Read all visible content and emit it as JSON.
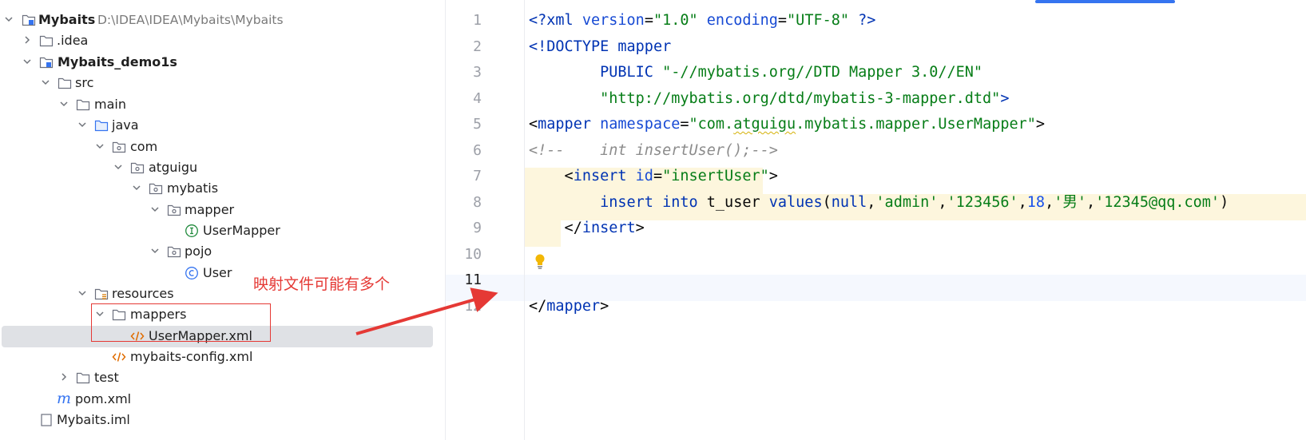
{
  "project_tree": {
    "root": {
      "name": "Mybaits",
      "path": "D:\\IDEA\\IDEA\\Mybaits\\Mybaits"
    },
    "items": [
      {
        "label": ".idea"
      },
      {
        "label": "Mybaits_demo1s"
      },
      {
        "label": "src"
      },
      {
        "label": "main"
      },
      {
        "label": "java"
      },
      {
        "label": "com"
      },
      {
        "label": "atguigu"
      },
      {
        "label": "mybatis"
      },
      {
        "label": "mapper"
      },
      {
        "label": "UserMapper"
      },
      {
        "label": "pojo"
      },
      {
        "label": "User"
      },
      {
        "label": "resources"
      },
      {
        "label": "mappers"
      },
      {
        "label": "UserMapper.xml"
      },
      {
        "label": "mybaits-config.xml"
      },
      {
        "label": "test"
      },
      {
        "label": "pom.xml"
      },
      {
        "label": "Mybaits.iml"
      }
    ]
  },
  "editor": {
    "file": "UserMapper.xml",
    "current_line": 11,
    "line_numbers": [
      "1",
      "2",
      "3",
      "4",
      "5",
      "6",
      "7",
      "8",
      "9",
      "10",
      "11",
      "12"
    ],
    "code": {
      "l1": {
        "a": "<?",
        "b": "xml",
        "c": " version",
        "d": "=",
        "e": "\"1.0\"",
        "f": " encoding",
        "g": "=",
        "h": "\"UTF-8\"",
        "i": " ?>"
      },
      "l2": {
        "a": "<!DOCTYPE ",
        "b": "mapper"
      },
      "l3": {
        "a": "        PUBLIC ",
        "b": "\"-//mybatis.org//DTD Mapper 3.0//EN\""
      },
      "l4": {
        "a": "        ",
        "b": "\"http://mybatis.org/dtd/mybatis-3-mapper.dtd\"",
        "c": ">"
      },
      "l5": {
        "a": "<",
        "b": "mapper",
        "c": " namespace",
        "d": "=",
        "e": "\"com.",
        "f": "atguigu",
        "g": ".mybatis.mapper.UserMapper\"",
        "h": ">"
      },
      "l6": {
        "a": "<!--    int insertUser();-->"
      },
      "l7": {
        "a": "    <",
        "b": "insert",
        "c": " id",
        "d": "=",
        "e": "\"insertUser\"",
        "f": ">"
      },
      "l8": {
        "a": "        ",
        "b": "insert",
        "c": " ",
        "d": "into",
        "e": " t_user ",
        "f": "values",
        "g": "(",
        "h": "null",
        "i": ",",
        "j": "'admin'",
        "k": ",",
        "l": "'123456'",
        "m": ",",
        "n": "18",
        "o": ",",
        "p": "'男'",
        "q": ",",
        "r": "'12345@qq.com'",
        "s": ")"
      },
      "l9": {
        "a": "    </",
        "b": "insert",
        "c": ">"
      },
      "l12": {
        "a": "</",
        "b": "mapper",
        "c": ">"
      }
    }
  },
  "annotation": {
    "text": "映射文件可能有多个",
    "color": "#e53935"
  },
  "colors": {
    "xml_tag": "#0033b3",
    "xml_string": "#067d17",
    "comment": "#8c8c8c",
    "selection": "#dfe1e5",
    "line_highlight": "#fdf6dd",
    "tab_indicator": "#3574f0"
  },
  "icons": [
    "module-folder-icon",
    "folder-icon",
    "source-folder-icon",
    "package-icon",
    "interface-icon",
    "class-icon",
    "resources-folder-icon",
    "xml-file-icon",
    "maven-icon",
    "iml-file-icon",
    "chevron-right-icon",
    "chevron-down-icon",
    "lightbulb-icon"
  ]
}
